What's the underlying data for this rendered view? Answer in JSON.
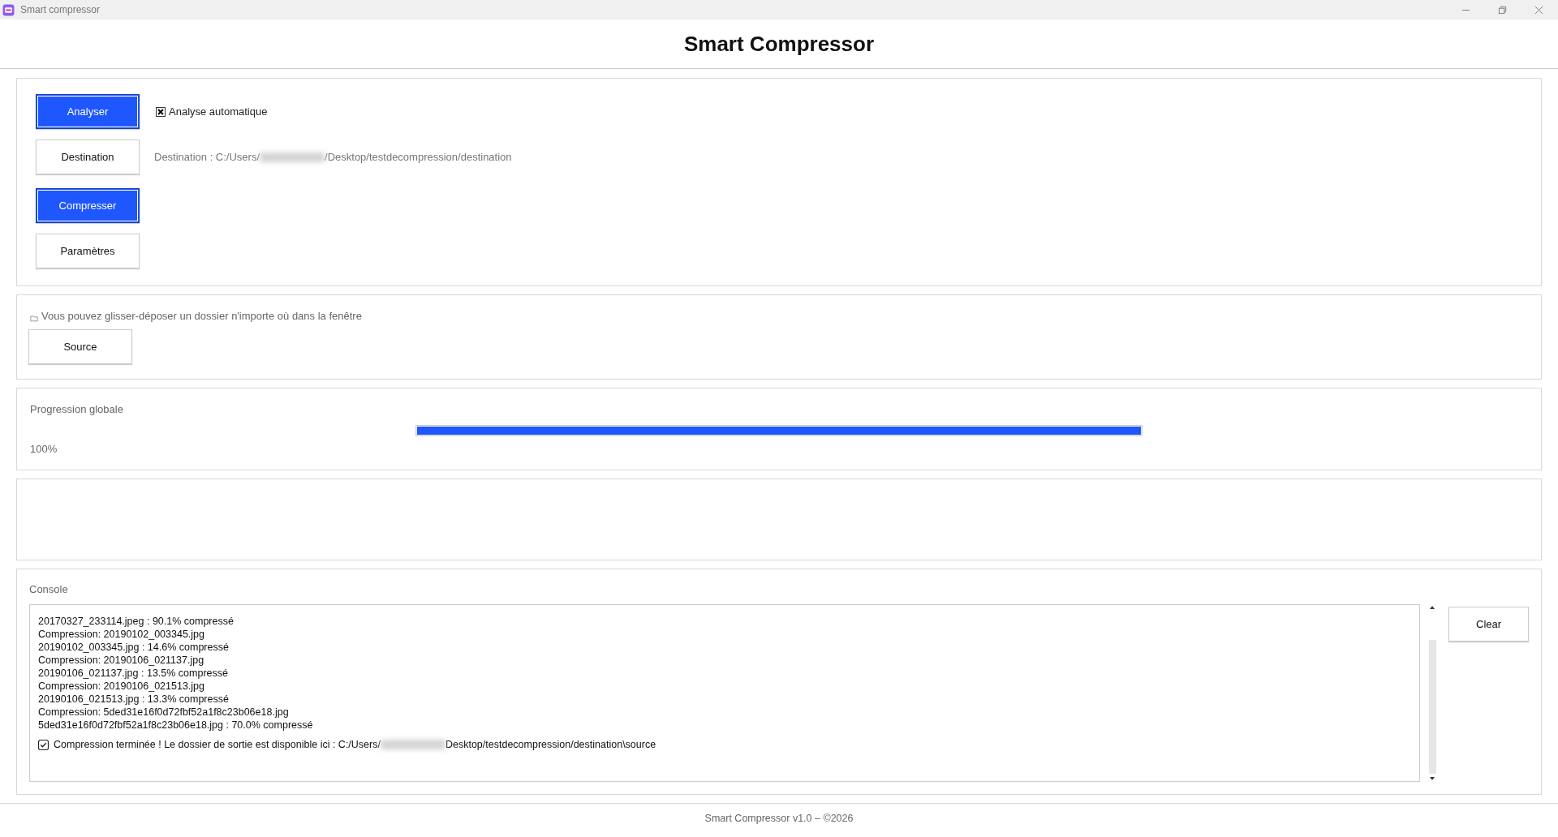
{
  "window": {
    "title": "Smart compressor"
  },
  "header": {
    "title": "Smart Compressor"
  },
  "actions": [
    {
      "label": "Analyser",
      "highlighted": true,
      "kind": "checkbox",
      "checkbox": {
        "label": "Analyse automatique",
        "checked": true
      }
    },
    {
      "label": "Destination",
      "highlighted": false,
      "kind": "path",
      "path_before": "Destination : C:/Users/",
      "path_after": "/Desktop/testdecompression/destination"
    },
    {
      "label": "Compresser",
      "highlighted": true,
      "kind": "none"
    },
    {
      "label": "Paramètres",
      "highlighted": false,
      "kind": "none"
    }
  ],
  "source": {
    "hint": "Vous pouvez glisser-déposer un dossier n'importe où dans la fenêtre",
    "button": "Source"
  },
  "progress": {
    "label": "Progression globale",
    "level": 1.0,
    "reading": "100%"
  },
  "console": {
    "label": "Console",
    "lines": [
      "20170327_233114.jpeg : 90.1% compressé",
      "Compression: 20190102_003345.jpg",
      "20190102_003345.jpg : 14.6% compressé",
      "Compression: 20190106_021137.jpg",
      "20190106_021137.jpg : 13.5% compressé",
      "Compression: 20190106_021513.jpg",
      "20190106_021513.jpg : 13.3% compressé",
      "Compression: 5ded31e16f0d72fbf52a1f8c23b06e18.jpg",
      "5ded31e16f0d72fbf52a1f8c23b06e18.jpg : 70.0% compressé"
    ],
    "done_before": "Compression terminée ! Le dossier de sortie est disponible ici : C:/Users/",
    "done_after": "Desktop/testdecompression/destination\\source",
    "clear": "Clear"
  },
  "footer": "Smart Compressor v1.0 – ©2026"
}
